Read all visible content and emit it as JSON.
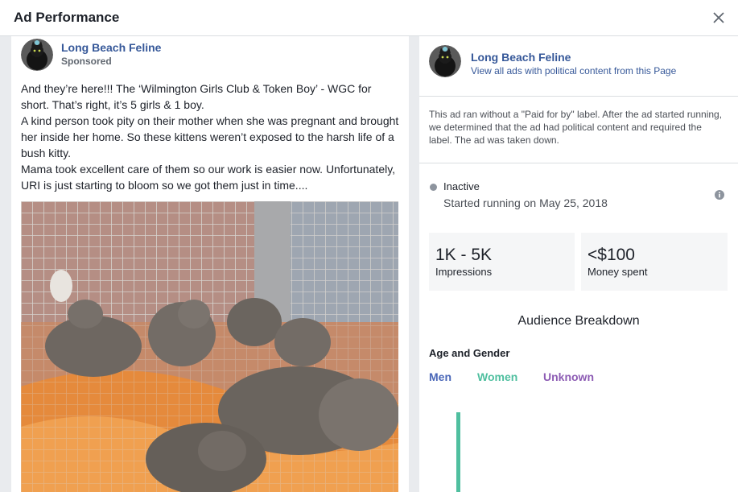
{
  "modal": {
    "title": "Ad Performance"
  },
  "ad": {
    "page_name": "Long Beach Feline",
    "sponsored_label": "Sponsored",
    "post_lines": [
      "And they’re here!!! The ‘Wilmington Girls Club & Token Boy’ - WGC for short. That’s right, it’s 5 girls & 1 boy.",
      "A kind person took pity on their mother when she was pregnant and brought her inside her home. So these kittens weren’t exposed to the harsh life of a bush kitty.",
      "Mama took excellent care of them so our work is easier now. Unfortunately, URI is just starting to bloom so we got them just in time...."
    ]
  },
  "details": {
    "page_name": "Long Beach Feline",
    "view_all_link": "View all ads with political content from this Page",
    "disclaimer": "This ad ran without a \"Paid for by\" label. After the ad started running, we determined that the ad had political content and required the label. The ad was taken down.",
    "status": "Inactive",
    "started": "Started running on May 25, 2018",
    "stats": [
      {
        "value": "1K - 5K",
        "label": "Impressions"
      },
      {
        "value": "<$100",
        "label": "Money spent"
      }
    ],
    "audience_title": "Audience Breakdown",
    "age_gender_label": "Age and Gender",
    "legend": [
      {
        "label": "Men",
        "color": "#4a67b8"
      },
      {
        "label": "Women",
        "color": "#4fbf9f"
      },
      {
        "label": "Unknown",
        "color": "#8d5cb4"
      }
    ]
  },
  "colors": {
    "link": "#365899",
    "status_dot": "#8d949e",
    "stat_bg": "#f5f6f7"
  }
}
